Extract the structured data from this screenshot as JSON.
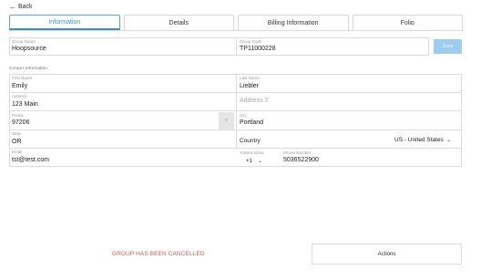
{
  "back": {
    "label": "Back"
  },
  "tabs": [
    {
      "label": "Information",
      "active": true
    },
    {
      "label": "Details",
      "active": false
    },
    {
      "label": "Billing Information",
      "active": false
    },
    {
      "label": "Folio",
      "active": false
    }
  ],
  "group": {
    "name_label": "Group Name",
    "name_value": "Hoopsource",
    "code_label": "Group Code",
    "code_value": "TP11000228",
    "save_label": "Save"
  },
  "contact": {
    "section_title": "Contact Information",
    "first_name_label": "First Name",
    "first_name_value": "Emily",
    "last_name_label": "Last Name",
    "last_name_value": "Liebler",
    "address_label": "Address",
    "address_value": "123 Main",
    "address2_placeholder": "Address 2",
    "postal_label": "Postal",
    "postal_value": "97206",
    "city_label": "City",
    "city_value": "Portland",
    "state_label": "State",
    "state_value": "OR",
    "country_label": "Country",
    "country_value": "US - United States",
    "email_label": "Email",
    "email_value": "tst@test.com",
    "extension_label": "Extens Sons",
    "extension_value": "+1",
    "phone_label": "Phone Number",
    "phone_value": "5036522900"
  },
  "footer": {
    "cancel_message": "GROUP HAS BEEN CANCELLED",
    "actions_label": "Actions"
  },
  "colors": {
    "accent": "#3b8fd9",
    "save_disabled": "#9fcdf0",
    "cancel_red": "#e05252"
  }
}
